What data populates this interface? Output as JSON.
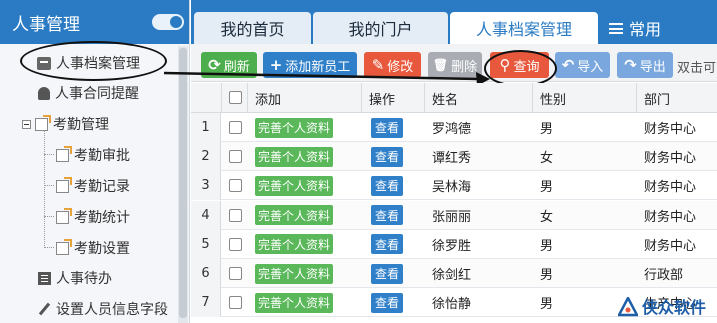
{
  "sidebar": {
    "title": "人事管理",
    "items": [
      {
        "label": "人事档案管理",
        "icon": "id-card-icon"
      },
      {
        "label": "人事合同提醒",
        "icon": "bell-icon"
      },
      {
        "label": "考勤管理",
        "icon": "folder-doc-icon"
      },
      {
        "label": "考勤审批",
        "icon": "doc-icon"
      },
      {
        "label": "考勤记录",
        "icon": "doc-icon"
      },
      {
        "label": "考勤统计",
        "icon": "doc-icon"
      },
      {
        "label": "考勤设置",
        "icon": "doc-icon"
      },
      {
        "label": "人事待办",
        "icon": "list-icon"
      },
      {
        "label": "设置人员信息字段",
        "icon": "pen-icon"
      }
    ]
  },
  "tabs": [
    {
      "label": "我的首页"
    },
    {
      "label": "我的门户"
    },
    {
      "label": "人事档案管理"
    },
    {
      "label": "常用",
      "icon": "menu-icon"
    }
  ],
  "toolbar": {
    "buttons": [
      {
        "label": "刷新",
        "glyph": "⟳",
        "color": "#4cae4c"
      },
      {
        "label": "添加新员工",
        "glyph": "+",
        "color": "#2f7fc9"
      },
      {
        "label": "修改",
        "glyph": "✎",
        "color": "#e8583c"
      },
      {
        "label": "删除",
        "glyph": "🗑",
        "color": "#a9adb3"
      },
      {
        "label": "查询",
        "glyph": "⚲",
        "color": "#e8583c"
      },
      {
        "label": "导入",
        "glyph": "↶",
        "color": "#7aa8de"
      },
      {
        "label": "导出",
        "glyph": "↷",
        "color": "#7aa8de"
      }
    ],
    "hint": "双击可"
  },
  "table": {
    "columns": [
      "添加",
      "操作",
      "姓名",
      "性别",
      "部门"
    ],
    "rows": [
      {
        "num": "1",
        "add": "完善个人资料",
        "op": "查看",
        "name": "罗鸿德",
        "gender": "男",
        "dept": "财务中心"
      },
      {
        "num": "2",
        "add": "完善个人资料",
        "op": "查看",
        "name": "谭红秀",
        "gender": "女",
        "dept": "财务中心"
      },
      {
        "num": "3",
        "add": "完善个人资料",
        "op": "查看",
        "name": "吴林海",
        "gender": "男",
        "dept": "财务中心"
      },
      {
        "num": "4",
        "add": "完善个人资料",
        "op": "查看",
        "name": "张丽丽",
        "gender": "女",
        "dept": "财务中心"
      },
      {
        "num": "5",
        "add": "完善个人资料",
        "op": "查看",
        "name": "徐罗胜",
        "gender": "男",
        "dept": "财务中心"
      },
      {
        "num": "6",
        "add": "完善个人资料",
        "op": "查看",
        "name": "徐剑红",
        "gender": "男",
        "dept": "行政部"
      },
      {
        "num": "7",
        "add": "完善个人资料",
        "op": "查看",
        "name": "徐怡静",
        "gender": "男",
        "dept": "生产中心"
      }
    ]
  },
  "watermark": {
    "text": "侠众软件"
  }
}
